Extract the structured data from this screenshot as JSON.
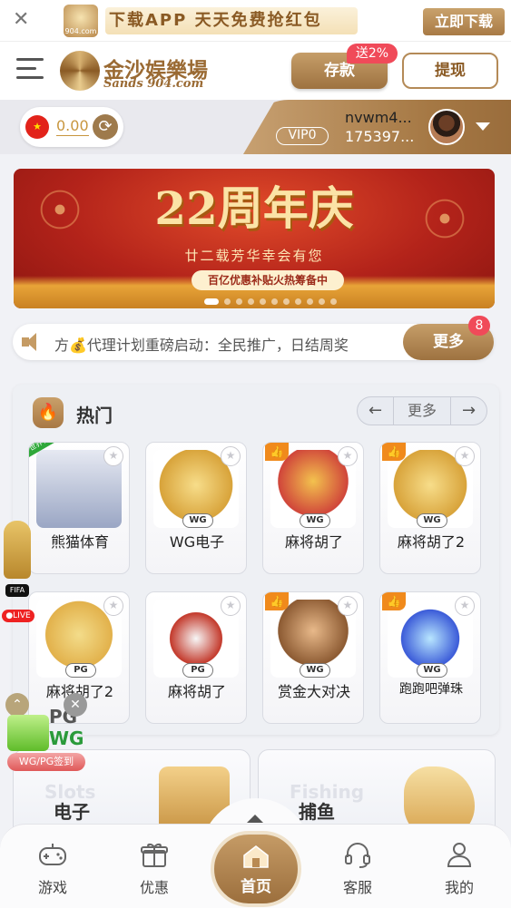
{
  "download_bar": {
    "close_icon": "close-icon",
    "logo_text": "904.com",
    "promo_text": "下载APP 天天免费抢红包",
    "button_label": "立即下载"
  },
  "header": {
    "brand_cn": "金沙娱樂場",
    "brand_en": "Sands 904.com",
    "deposit_label": "存款",
    "deposit_badge": "送2%",
    "withdraw_label": "提现"
  },
  "account": {
    "currency_flag": "★",
    "balance": "0.00",
    "vip_level": "VIP0",
    "username": "nvwm4...",
    "user_id": "175397..."
  },
  "banner": {
    "title": "22周年庆",
    "subtitle": "廿二载芳华幸会有您",
    "tagline": "百亿优惠补贴火热筹备中",
    "slide_count": 11,
    "active_slide": 0
  },
  "marquee": {
    "text": "方💰代理计划重磅启动：全民推广，日结周奖",
    "more_label": "更多",
    "badge_count": "8"
  },
  "hot_section": {
    "title": "热门",
    "nav_prev": "←",
    "nav_more": "更多",
    "nav_next": "→",
    "games": [
      {
        "name": "熊猫体育",
        "vendor": "",
        "hot": false,
        "world": "世界杯"
      },
      {
        "name": "WG电子",
        "vendor": "WG",
        "hot": false,
        "world": ""
      },
      {
        "name": "麻将胡了",
        "vendor": "WG",
        "hot": true,
        "world": ""
      },
      {
        "name": "麻将胡了2",
        "vendor": "WG",
        "hot": true,
        "world": ""
      },
      {
        "name": "麻将胡了2",
        "vendor": "PG",
        "hot": false,
        "world": ""
      },
      {
        "name": "麻将胡了",
        "vendor": "PG",
        "hot": false,
        "world": ""
      },
      {
        "name": "赏金大对决",
        "vendor": "WG",
        "hot": true,
        "world": ""
      },
      {
        "name": "跑跑吧弹珠",
        "vendor": "WG",
        "hot": true,
        "world": ""
      }
    ]
  },
  "float_widgets": {
    "fifa_label": "FIFA",
    "live_label": "●LIVE",
    "sign_brands_top": "PG",
    "sign_brands_bottom": "WG",
    "sign_label": "WG/PG签到"
  },
  "categories": [
    {
      "ghost": "Slots",
      "name": "电子"
    },
    {
      "ghost": "Fishing",
      "name": "捕鱼"
    }
  ],
  "bottom_nav": {
    "items": [
      "游戏",
      "优惠",
      "首页",
      "客服",
      "我的"
    ]
  },
  "colors": {
    "accent_gold": "#a87a45",
    "badge_red": "#f04a59",
    "hot_orange": "#f08a1c"
  }
}
